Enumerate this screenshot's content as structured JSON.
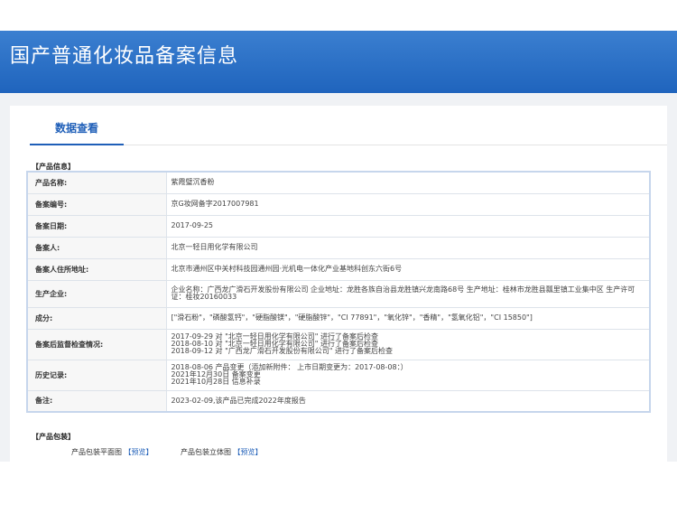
{
  "header": {
    "title": "国产普通化妆品备案信息"
  },
  "tabs": [
    {
      "label": "数据查看"
    }
  ],
  "product_info": {
    "section_title": "【产品信息】",
    "rows": [
      {
        "label": "产品名称:",
        "value": "紫霞璧沉香粉"
      },
      {
        "label": "备案编号:",
        "value": "京G妆网备字2017007981"
      },
      {
        "label": "备案日期:",
        "value": "2017-09-25"
      },
      {
        "label": "备案人:",
        "value": "北京一轻日用化学有限公司"
      },
      {
        "label": "备案人住所地址:",
        "value": "北京市通州区中关村科技园通州园·光机电一体化产业基地科创东六街6号"
      },
      {
        "label": "生产企业:",
        "value": "企业名称：广西龙广滑石开发股份有限公司 企业地址：龙胜各族自治县龙胜镇兴龙南路68号 生产地址：桂林市龙胜县瓢里镇工业集中区 生产许可证：桂妆20160033"
      },
      {
        "label": "成分:",
        "value": "[\"滑石粉\"，\"磷酸氢钙\"，\"硬脂酸镁\"，\"硬脂酸锌\"，\"CI 77891\"，\"氧化锌\"，\"香精\"，\"氢氧化铝\"，\"CI 15850\"]"
      },
      {
        "label": "备案后监督检查情况:",
        "value": "2017-09-29 对 \"北京一轻日用化学有限公司\" 进行了备案后检查\n2018-08-10 对 \"北京一轻日用化学有限公司\" 进行了备案后检查\n2018-09-12 对 \"广西龙广滑石开发股份有限公司\" 进行了备案后检查"
      },
      {
        "label": "历史记录:",
        "value": "2018-08-06 产品变更（添加新附件： 上市日期变更为：2017-08-08：）\n2021年12月30日 备案变更\n2021年10月28日 信息补录"
      },
      {
        "label": "备注:",
        "value": "2023-02-09,该产品已完成2022年度报告"
      }
    ]
  },
  "package": {
    "section_title": "【产品包装】",
    "items": [
      {
        "label": "产品包装平面图",
        "link": "【预览】"
      },
      {
        "label": "产品包装立体图",
        "link": "【预览】"
      }
    ]
  }
}
